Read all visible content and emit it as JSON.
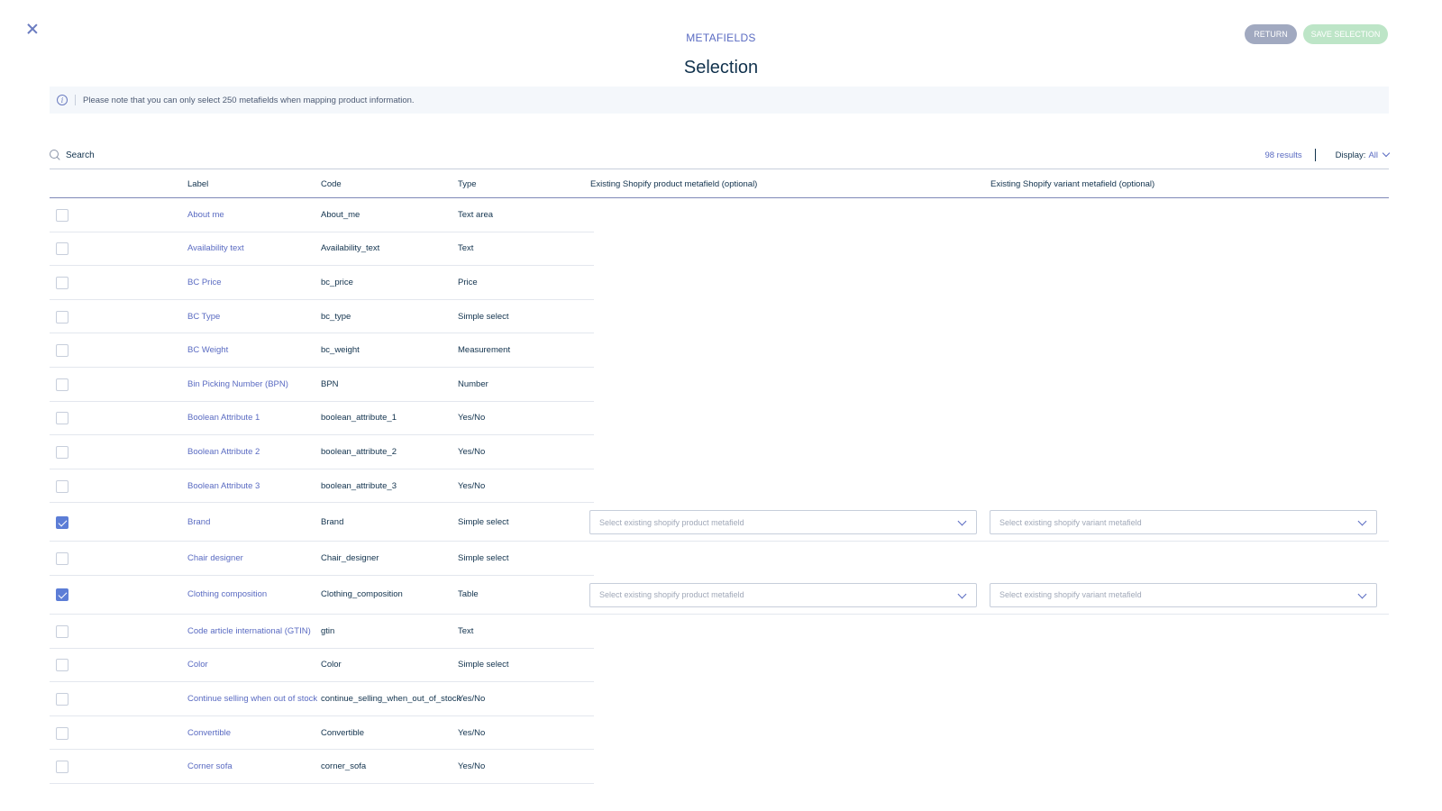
{
  "header": {
    "subtitle": "METAFIELDS",
    "title": "Selection",
    "return_label": "RETURN",
    "save_label": "SAVE SELECTION"
  },
  "notice": {
    "text": "Please note that you can only select 250 metafields when mapping product information."
  },
  "search": {
    "placeholder": "Search",
    "results": "98 results",
    "display_label": "Display:",
    "display_value": "All"
  },
  "table": {
    "columns": {
      "label": "Label",
      "code": "Code",
      "type": "Type",
      "product_metafield": "Existing Shopify product metafield (optional)",
      "variant_metafield": "Existing Shopify variant metafield (optional)"
    },
    "select_product_placeholder": "Select existing shopify product metafield",
    "select_variant_placeholder": "Select existing shopify variant metafield",
    "rows": [
      {
        "label": "About me",
        "code": "About_me",
        "type": "Text area",
        "checked": false
      },
      {
        "label": "Availability text",
        "code": "Availability_text",
        "type": "Text",
        "checked": false
      },
      {
        "label": "BC Price",
        "code": "bc_price",
        "type": "Price",
        "checked": false
      },
      {
        "label": "BC Type",
        "code": "bc_type",
        "type": "Simple select",
        "checked": false
      },
      {
        "label": "BC Weight",
        "code": "bc_weight",
        "type": "Measurement",
        "checked": false
      },
      {
        "label": "Bin Picking Number (BPN)",
        "code": "BPN",
        "type": "Number",
        "checked": false
      },
      {
        "label": "Boolean Attribute 1",
        "code": "boolean_attribute_1",
        "type": "Yes/No",
        "checked": false
      },
      {
        "label": "Boolean Attribute 2",
        "code": "boolean_attribute_2",
        "type": "Yes/No",
        "checked": false
      },
      {
        "label": "Boolean Attribute 3",
        "code": "boolean_attribute_3",
        "type": "Yes/No",
        "checked": false
      },
      {
        "label": "Brand",
        "code": "Brand",
        "type": "Simple select",
        "checked": true
      },
      {
        "label": "Chair designer",
        "code": "Chair_designer",
        "type": "Simple select",
        "checked": false
      },
      {
        "label": "Clothing composition",
        "code": "Clothing_composition",
        "type": "Table",
        "checked": true
      },
      {
        "label": "Code article international (GTIN)",
        "code": "gtin",
        "type": "Text",
        "checked": false
      },
      {
        "label": "Color",
        "code": "Color",
        "type": "Simple select",
        "checked": false
      },
      {
        "label": "Continue selling when out of stock",
        "code": "continue_selling_when_out_of_stock",
        "type": "Yes/No",
        "checked": false
      },
      {
        "label": "Convertible",
        "code": "Convertible",
        "type": "Yes/No",
        "checked": false
      },
      {
        "label": "Corner sofa",
        "code": "corner_sofa",
        "type": "Yes/No",
        "checked": false
      }
    ]
  },
  "icons": {
    "close": "close-icon",
    "info": "info-icon",
    "search": "search-icon",
    "chevron": "chevron-down-icon"
  },
  "colors": {
    "accent": "#5a6bc2",
    "checkbox_checked": "#5c7dd6",
    "return_button": "#a1a9c0",
    "save_button": "#bde5c7"
  }
}
